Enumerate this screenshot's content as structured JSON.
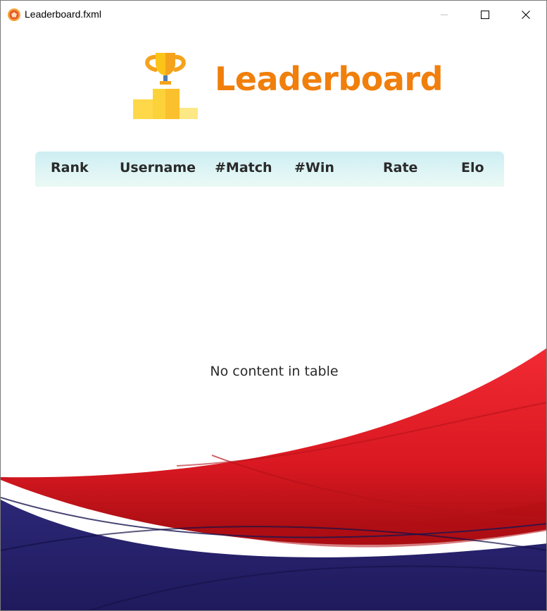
{
  "window": {
    "title": "Leaderboard.fxml",
    "controls": [
      "minimize-icon",
      "maximize-icon",
      "close-icon"
    ]
  },
  "header": {
    "title": "Leaderboard",
    "icon": "trophy-podium-icon"
  },
  "table": {
    "columns": [
      "Rank",
      "Username",
      "#Match",
      "#Win",
      "Rate",
      "Elo"
    ],
    "rows": [],
    "empty_message": "No content in table"
  },
  "colors": {
    "title_accent": "#f07f0c",
    "header_bg": "#d3f0f3",
    "wave_red": "#e61e26",
    "wave_navy": "#2b2470"
  }
}
